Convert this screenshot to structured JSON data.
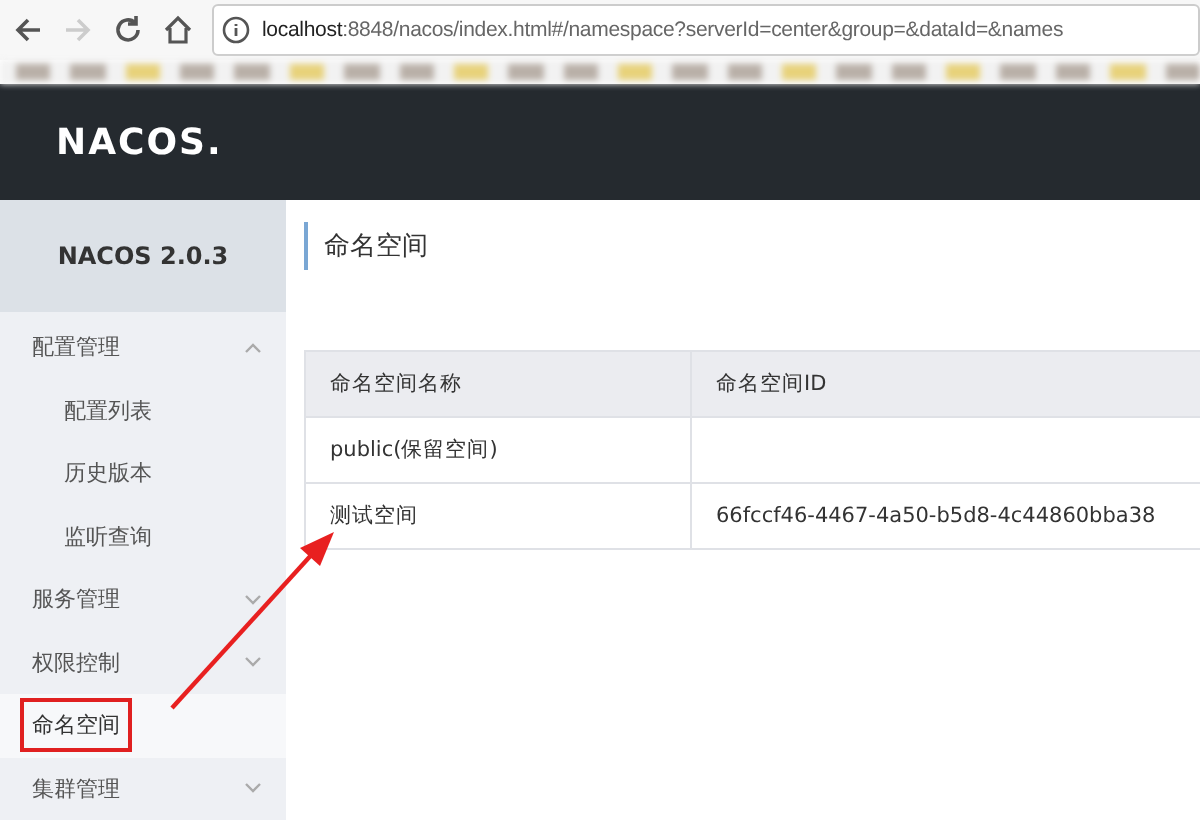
{
  "browser": {
    "url_host": "localhost",
    "url_path": ":8848/nacos/index.html#/namespace?serverId=center&group=&dataId=&names"
  },
  "header": {
    "logo": "NACOS."
  },
  "sidebar": {
    "version": "NACOS 2.0.3",
    "items": [
      {
        "label": "配置管理",
        "expanded": true,
        "selected": false,
        "annotated": false,
        "children": [
          {
            "label": "配置列表",
            "selected": false
          },
          {
            "label": "历史版本",
            "selected": false
          },
          {
            "label": "监听查询",
            "selected": false
          }
        ]
      },
      {
        "label": "服务管理",
        "expanded": false,
        "selected": false,
        "annotated": false
      },
      {
        "label": "权限控制",
        "expanded": false,
        "selected": false,
        "annotated": false
      },
      {
        "label": "命名空间",
        "selected": true,
        "annotated": true
      },
      {
        "label": "集群管理",
        "expanded": false,
        "selected": false,
        "annotated": false
      }
    ]
  },
  "page": {
    "title": "命名空间",
    "annotation_arrow": true
  },
  "table": {
    "columns": [
      "命名空间名称",
      "命名空间ID"
    ],
    "rows": [
      {
        "cells": [
          "public(保留空间)",
          ""
        ]
      },
      {
        "cells": [
          "测试空间",
          "66fccf46-4467-4a50-b5d8-4c44860bba38"
        ]
      }
    ]
  }
}
